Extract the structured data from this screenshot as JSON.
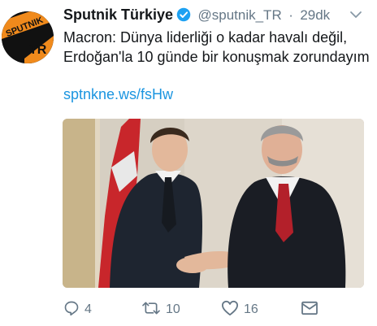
{
  "account": {
    "name": "Sputnik Türkiye",
    "handle": "@sputnik_TR",
    "separator": "·",
    "time": "29dk",
    "avatar_text_top": "SPUTNIK",
    "avatar_text_bottom": "TR"
  },
  "tweet": {
    "text": "Macron: Dünya liderliği o kadar havalı değil, Erdoğan'la 10 günde bir konuşmak zorundayım",
    "link": "sptnkne.ws/fsHw"
  },
  "actions": {
    "replies": "4",
    "retweets": "10",
    "likes": "16"
  },
  "colors": {
    "brand_orange": "#f08a1c",
    "link_blue": "#1b95e0",
    "muted_gray": "#657786",
    "verified_blue": "#1da1f2"
  },
  "icons": [
    "verified-badge-icon",
    "chevron-down-icon",
    "reply-icon",
    "retweet-icon",
    "like-icon",
    "message-icon"
  ]
}
